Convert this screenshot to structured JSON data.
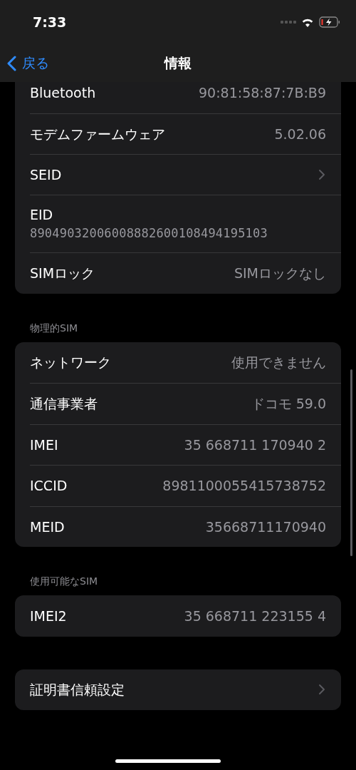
{
  "status_bar": {
    "time": "7:33"
  },
  "nav": {
    "back": "戻る",
    "title": "情報"
  },
  "sections": [
    {
      "rows": [
        {
          "kind": "value",
          "label": "Bluetooth",
          "value": "90:81:58:87:7B:B9"
        },
        {
          "kind": "value",
          "label": "モデムファームウェア",
          "value": "5.02.06"
        },
        {
          "kind": "chevron",
          "label": "SEID"
        },
        {
          "kind": "stacked",
          "label": "EID",
          "value": "89049032006008882600108494195103"
        },
        {
          "kind": "value",
          "label": "SIMロック",
          "value": "SIMロックなし"
        }
      ]
    },
    {
      "header": "物理的SIM",
      "rows": [
        {
          "kind": "value",
          "label": "ネットワーク",
          "value": "使用できません"
        },
        {
          "kind": "value",
          "label": "通信事業者",
          "value": "ドコモ 59.0"
        },
        {
          "kind": "value",
          "label": "IMEI",
          "value": "35 668711 170940 2"
        },
        {
          "kind": "value",
          "label": "ICCID",
          "value": "8981100055415738752"
        },
        {
          "kind": "value",
          "label": "MEID",
          "value": "35668711170940"
        }
      ]
    },
    {
      "header": "使用可能なSIM",
      "rows": [
        {
          "kind": "value",
          "label": "IMEI2",
          "value": "35 668711 223155 4"
        }
      ]
    },
    {
      "rows": [
        {
          "kind": "chevron",
          "label": "証明書信頼設定"
        }
      ]
    }
  ]
}
